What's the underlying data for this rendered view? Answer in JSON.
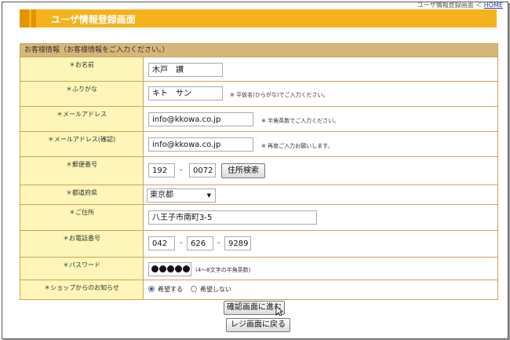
{
  "breadcrumb": {
    "text": "ユーザ情報登録画面 ＜ ",
    "home": "HOME"
  },
  "page_title": "ユーザ情報登録画面",
  "section_title": "お客様情報（お客様情報をご入力ください。）",
  "rows": {
    "name": {
      "label": "＊お名前",
      "value": "木戸　讃"
    },
    "kana": {
      "label": "＊ふりがな",
      "value": "キト　サン",
      "note": "※ 平仮名(ひらがな)でご入力ください。"
    },
    "email": {
      "label": "＊メールアドレス",
      "value": "info@kkowa.co.jp",
      "note": "※ 半角英数でご入力ください。"
    },
    "email_confirm": {
      "label": "＊メールアドレス(確認)",
      "value": "info@kkowa.co.jp",
      "note": "※ 再度ご入力お願いします。"
    },
    "postal": {
      "label": "＊郵便番号",
      "value1": "192",
      "value2": "0072",
      "search_button": "住所検索"
    },
    "prefecture": {
      "label": "＊都道府県",
      "value": "東京都"
    },
    "address": {
      "label": "＊ご住所",
      "value": "八王子市南町3-5"
    },
    "phone": {
      "label": "＊お電話番号",
      "value1": "042",
      "value2": "626",
      "value3": "9289"
    },
    "password": {
      "label": "＊パスワード",
      "note": "(4～8文字の半角英数)"
    },
    "newsletter": {
      "label": "＊ショップからのお知らせ",
      "option_yes": "希望する",
      "option_no": "希望しない",
      "selected": "yes"
    }
  },
  "buttons": {
    "confirm": "確認画面に進む",
    "back": "レジ画面に戻る"
  }
}
